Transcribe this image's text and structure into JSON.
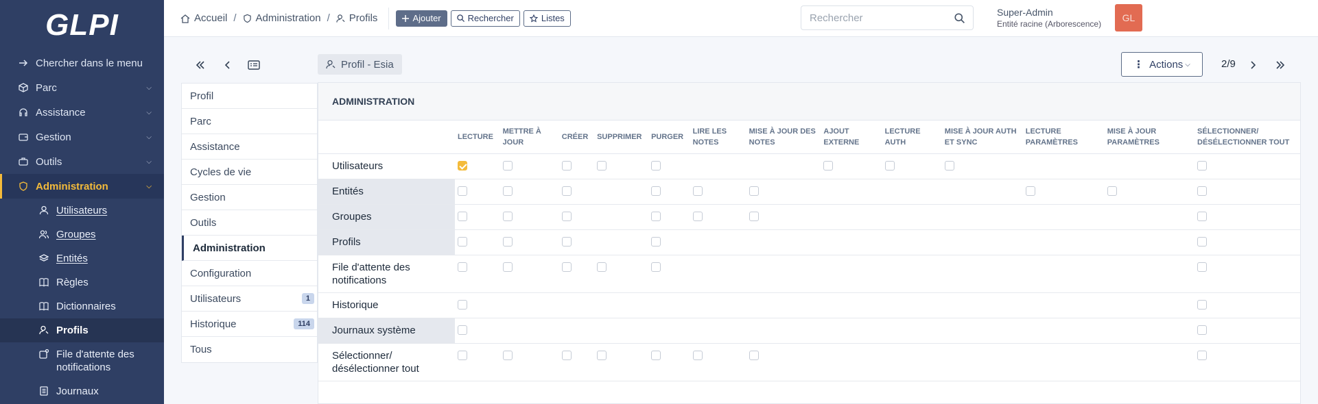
{
  "app": {
    "logo": "GLPI"
  },
  "sidebar": {
    "search_label": "Chercher dans le menu",
    "sections": [
      {
        "label": "Parc"
      },
      {
        "label": "Assistance"
      },
      {
        "label": "Gestion"
      },
      {
        "label": "Outils"
      },
      {
        "label": "Administration"
      }
    ],
    "subitems": [
      {
        "label": "Utilisateurs"
      },
      {
        "label": "Groupes"
      },
      {
        "label": "Entités"
      },
      {
        "label": "Règles"
      },
      {
        "label": "Dictionnaires"
      },
      {
        "label": "Profils"
      },
      {
        "label": "File d'attente des notifications"
      },
      {
        "label": "Journaux"
      }
    ]
  },
  "header": {
    "breadcrumb": [
      "Accueil",
      "Administration",
      "Profils"
    ],
    "buttons": {
      "add": "Ajouter",
      "search": "Rechercher",
      "lists": "Listes"
    },
    "search_placeholder": "Rechercher",
    "user_name": "Super-Admin",
    "user_entity": "Entité racine (Arborescence)",
    "avatar_initials": "GL"
  },
  "item": {
    "title": "Profil - Esia",
    "actions_label": "Actions",
    "pager": "2/9"
  },
  "tabs": [
    {
      "label": "Profil"
    },
    {
      "label": "Parc"
    },
    {
      "label": "Assistance"
    },
    {
      "label": "Cycles de vie"
    },
    {
      "label": "Gestion"
    },
    {
      "label": "Outils"
    },
    {
      "label": "Administration"
    },
    {
      "label": "Configuration"
    },
    {
      "label": "Utilisateurs",
      "badge": "1"
    },
    {
      "label": "Historique",
      "badge": "114"
    },
    {
      "label": "Tous"
    }
  ],
  "rights": {
    "section_title": "ADMINISTRATION",
    "columns": [
      "Lecture",
      "Mettre à jour",
      "Créer",
      "Supprimer",
      "Purger",
      "Lire les notes",
      "Mise à jour des notes",
      "Ajout externe",
      "Lecture auth",
      "Mise à jour auth et sync",
      "Lecture paramètres",
      "Mise à jour paramètres",
      "Sélectionner/ désélectionner tout"
    ],
    "rows": [
      {
        "label": "Utilisateurs",
        "cells": [
          2,
          1,
          1,
          1,
          1,
          0,
          0,
          1,
          1,
          1,
          0,
          0,
          1
        ]
      },
      {
        "label": "Entités",
        "cells": [
          1,
          1,
          1,
          0,
          1,
          1,
          1,
          0,
          0,
          0,
          1,
          1,
          1
        ]
      },
      {
        "label": "Groupes",
        "cells": [
          1,
          1,
          1,
          0,
          1,
          1,
          1,
          0,
          0,
          0,
          0,
          0,
          1
        ]
      },
      {
        "label": "Profils",
        "cells": [
          1,
          1,
          1,
          0,
          1,
          0,
          0,
          0,
          0,
          0,
          0,
          0,
          1
        ]
      },
      {
        "label": "File d'attente des notifications",
        "cells": [
          1,
          1,
          1,
          1,
          1,
          0,
          0,
          0,
          0,
          0,
          0,
          0,
          1
        ]
      },
      {
        "label": "Historique",
        "cells": [
          1,
          0,
          0,
          0,
          0,
          0,
          0,
          0,
          0,
          0,
          0,
          0,
          1
        ]
      },
      {
        "label": "Journaux système",
        "cells": [
          1,
          0,
          0,
          0,
          0,
          0,
          0,
          0,
          0,
          0,
          0,
          0,
          1
        ]
      },
      {
        "label": "Sélectionner/ désélectionner tout",
        "cells": [
          1,
          1,
          1,
          1,
          1,
          1,
          1,
          0,
          0,
          0,
          0,
          0,
          1
        ]
      }
    ]
  }
}
